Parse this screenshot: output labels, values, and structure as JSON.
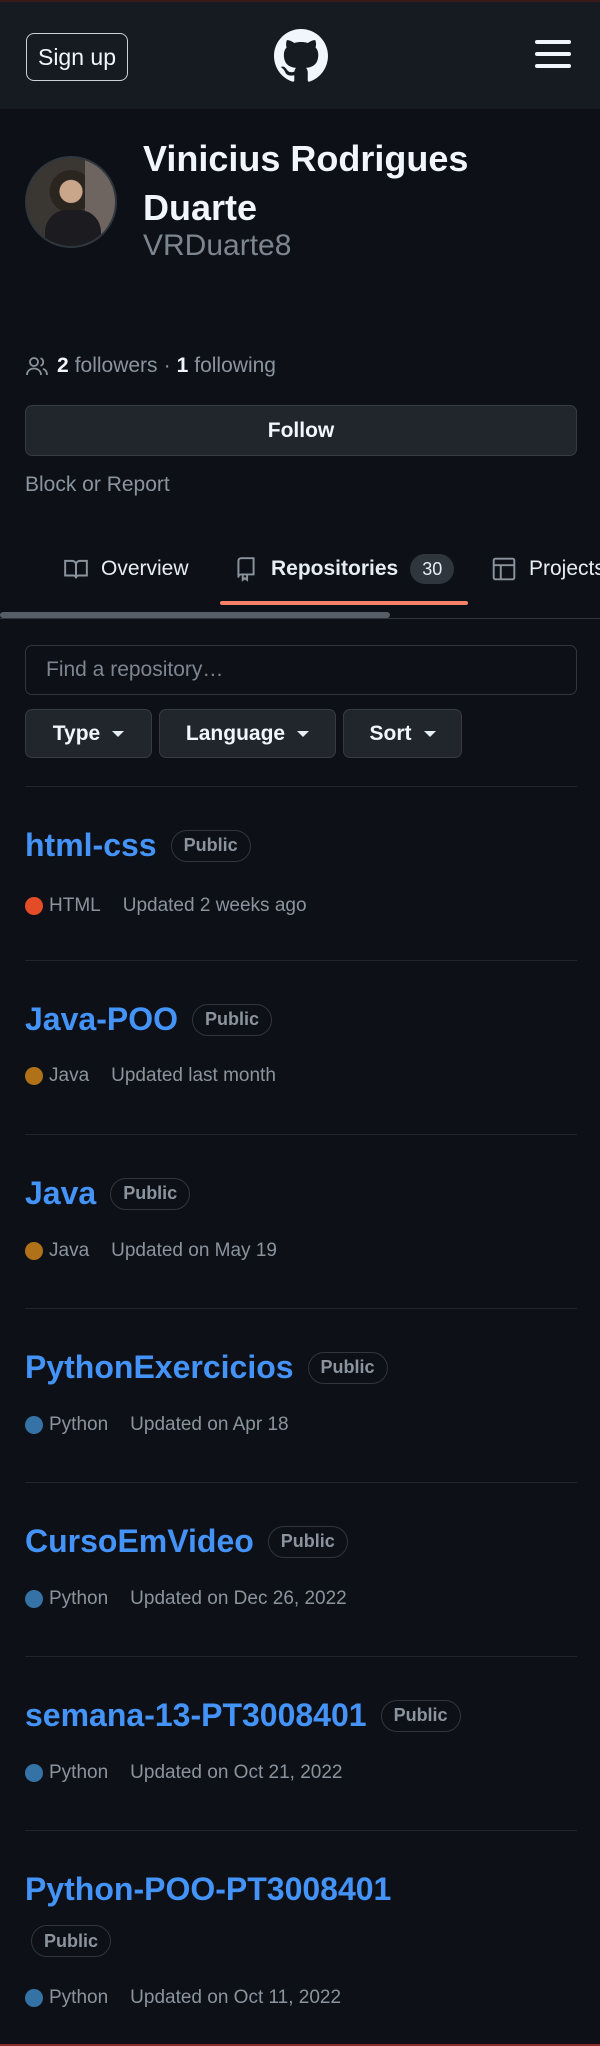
{
  "header": {
    "signup_label": "Sign up",
    "logo_icon": "github-octocat-icon",
    "menu_icon": "hamburger-menu-icon"
  },
  "profile": {
    "name": "Vinicius Rodrigues Duarte",
    "username": "VRDuarte8",
    "followers_count": "2",
    "followers_label": "followers",
    "separator": "·",
    "following_count": "1",
    "following_label": "following",
    "follow_label": "Follow",
    "block_label": "Block or Report"
  },
  "tabs": [
    {
      "label": "Overview",
      "icon": "book-icon"
    },
    {
      "label": "Repositories",
      "icon": "repo-icon",
      "count": "30",
      "selected": true
    },
    {
      "label": "Projects",
      "icon": "table-icon"
    }
  ],
  "search": {
    "placeholder": "Find a repository…"
  },
  "filters": {
    "type_label": "Type",
    "language_label": "Language",
    "sort_label": "Sort"
  },
  "repos": [
    {
      "name": "html-css",
      "visibility": "Public",
      "language": "HTML",
      "lang_color": "#e34c26",
      "updated": "Updated 2 weeks ago"
    },
    {
      "name": "Java-POO",
      "visibility": "Public",
      "language": "Java",
      "lang_color": "#b07219",
      "updated": "Updated last month"
    },
    {
      "name": "Java",
      "visibility": "Public",
      "language": "Java",
      "lang_color": "#b07219",
      "updated": "Updated on May 19"
    },
    {
      "name": "PythonExercicios",
      "visibility": "Public",
      "language": "Python",
      "lang_color": "#3572A5",
      "updated": "Updated on Apr 18"
    },
    {
      "name": "CursoEmVideo",
      "visibility": "Public",
      "language": "Python",
      "lang_color": "#3572A5",
      "updated": "Updated on Dec 26, 2022"
    },
    {
      "name": "semana-13-PT3008401",
      "visibility": "Public",
      "language": "Python",
      "lang_color": "#3572A5",
      "updated": "Updated on Oct 21, 2022"
    },
    {
      "name": "Python-POO-PT3008401",
      "visibility": "Public",
      "language": "Python",
      "lang_color": "#3572A5",
      "updated": "Updated on Oct 11, 2022"
    }
  ],
  "colors": {
    "background": "#0d1117",
    "header": "#161b22",
    "link": "#4493f8",
    "tab_underline": "#f78166"
  }
}
